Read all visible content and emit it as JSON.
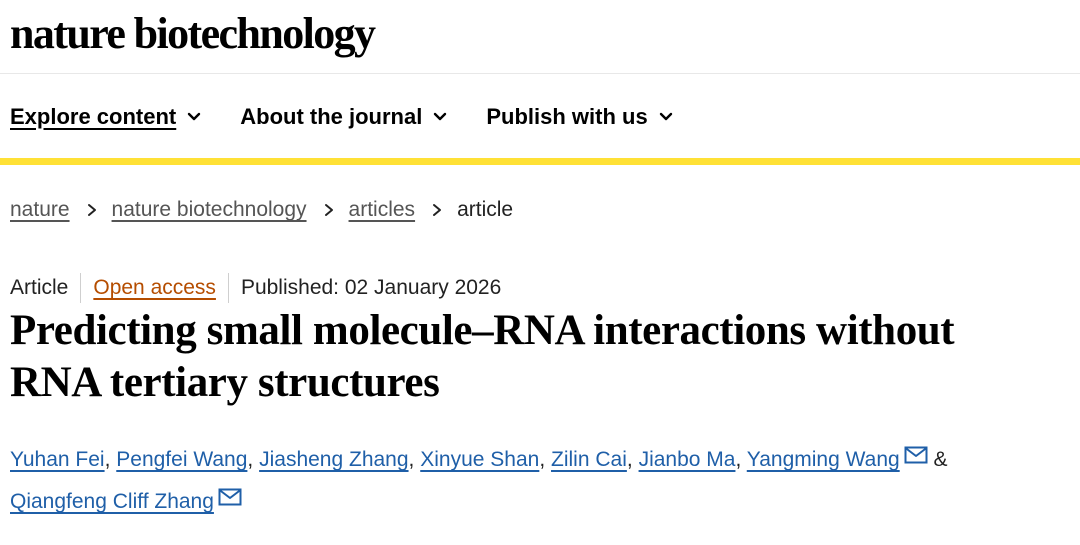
{
  "header": {
    "logo": "nature biotechnology"
  },
  "nav": {
    "items": [
      {
        "label": "Explore content",
        "icon": "chevron-down-icon"
      },
      {
        "label": "About the journal",
        "icon": "chevron-down-icon"
      },
      {
        "label": "Publish with us",
        "icon": "chevron-down-icon"
      }
    ]
  },
  "breadcrumb": {
    "items": [
      "nature",
      "nature biotechnology",
      "articles",
      "article"
    ],
    "separator_icon": "chevron-right-icon"
  },
  "article": {
    "type": "Article",
    "access": "Open access",
    "published": "Published: 02 January 2026",
    "title_line1": "Predicting small molecule–RNA interactions without",
    "title_line2": "RNA tertiary structures",
    "authors": [
      "Yuhan Fei",
      "Pengfei Wang",
      "Jiasheng Zhang",
      "Xinyue Shan",
      "Zilin Cai",
      "Jianbo Ma",
      "Yangming Wang",
      "Qiangfeng Cliff Zhang"
    ],
    "author_separator": ",",
    "and_symbol": "&",
    "mail_icon": "mail-icon"
  },
  "colors": {
    "accent_yellow": "#ffe136",
    "open_access": "#b54d00",
    "author_link": "#1f5fa8"
  }
}
